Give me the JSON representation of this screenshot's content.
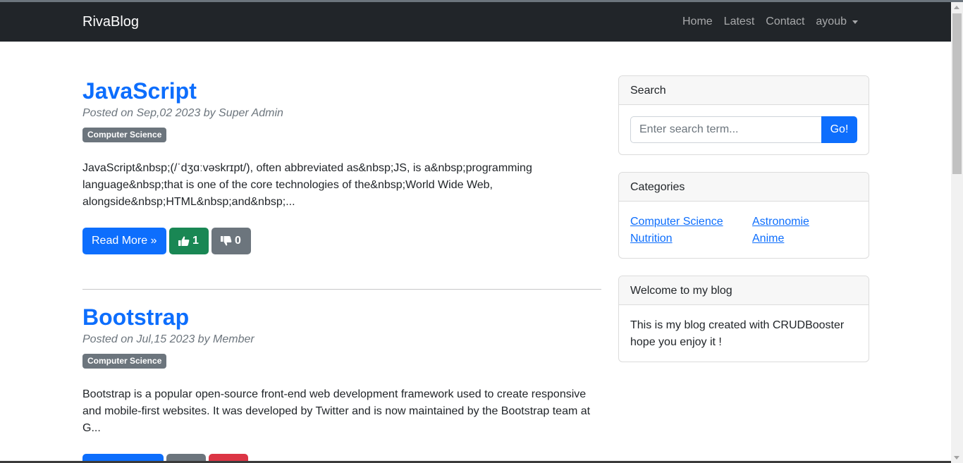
{
  "navbar": {
    "brand": "RivaBlog",
    "links": [
      {
        "label": "Home"
      },
      {
        "label": "Latest"
      },
      {
        "label": "Contact"
      }
    ],
    "user": "ayoub"
  },
  "posts": [
    {
      "title": "JavaScript",
      "meta": "Posted on Sep,02 2023 by Super Admin",
      "category": "Computer Science",
      "excerpt": "JavaScript&nbsp;(/ˈdʒɑːvəskrɪpt/), often abbreviated as&nbsp;JS, is a&nbsp;programming language&nbsp;that is one of the core technologies of the&nbsp;World Wide Web, alongside&nbsp;HTML&nbsp;and&nbsp;...",
      "read_more": "Read More »",
      "likes": "1",
      "dislikes": "0"
    },
    {
      "title": "Bootstrap",
      "meta": "Posted on Jul,15 2023 by Member",
      "category": "Computer Science",
      "excerpt": "Bootstrap is a popular open-source front-end web development framework used to create responsive and mobile-first websites. It was developed by Twitter and is now maintained by the Bootstrap team at G..."
    }
  ],
  "sidebar": {
    "search": {
      "header": "Search",
      "placeholder": "Enter search term...",
      "button": "Go!"
    },
    "categories": {
      "header": "Categories",
      "items": [
        "Computer Science",
        "Astronomie",
        "Nutrition",
        "Anime"
      ]
    },
    "welcome": {
      "header": "Welcome to my blog",
      "text": "This is my blog created with CRUDBooster hope you enjoy it !"
    }
  },
  "colors": {
    "navbar_bg": "#212529",
    "primary": "#0d6efd",
    "success": "#198754",
    "secondary": "#6c757d",
    "danger": "#dc3545"
  }
}
